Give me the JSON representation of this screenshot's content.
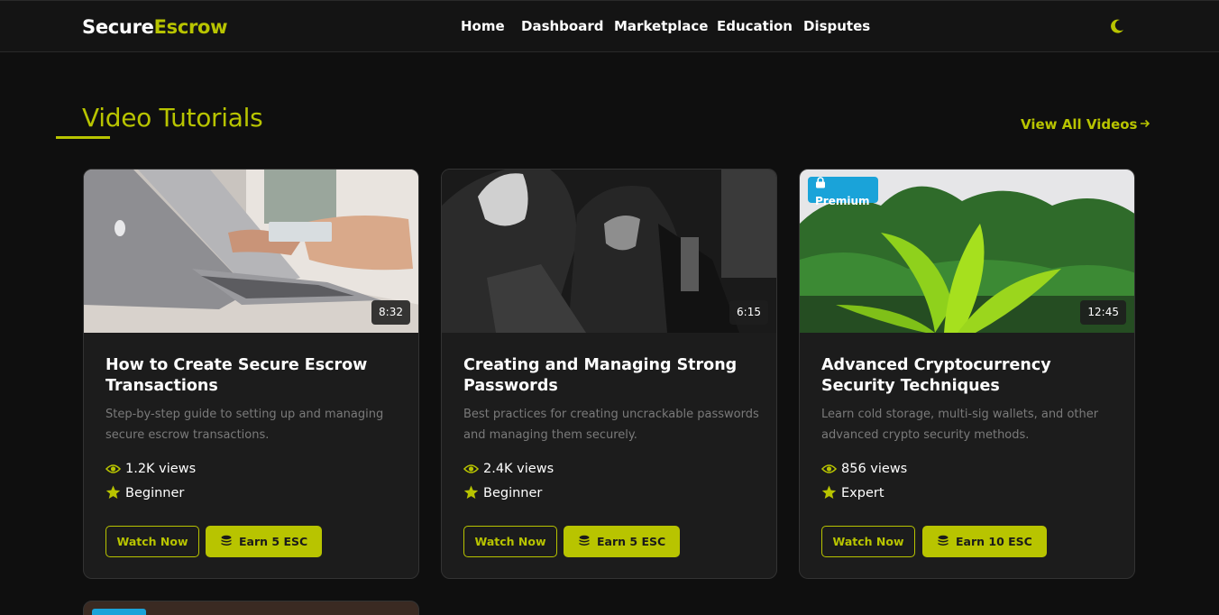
{
  "brand": {
    "part1": "Secure",
    "part2": "Escrow"
  },
  "nav": {
    "links": [
      "Home",
      "Dashboard",
      "Marketplace",
      "Education",
      "Disputes"
    ],
    "theme_icon": "moon-icon"
  },
  "section": {
    "title": "Video Tutorials",
    "view_all": "View All Videos",
    "view_all_icon": "arrow-right-icon"
  },
  "colors": {
    "accent": "#b8c400",
    "premium": "#1aa3d9",
    "background": "#0f0f0f",
    "card": "#1c1c1c"
  },
  "cards": [
    {
      "duration": "8:32",
      "premium": false,
      "title": "How to Create Secure Escrow Transactions",
      "description": "Step-by-step guide to setting up and managing secure escrow transactions.",
      "views": "1.2K views",
      "level": "Beginner",
      "watch_label": "Watch Now",
      "earn_label": "Earn 5 ESC"
    },
    {
      "duration": "6:15",
      "premium": false,
      "title": "Creating and Managing Strong Passwords",
      "description": "Best practices for creating uncrackable passwords and managing them securely.",
      "views": "2.4K views",
      "level": "Beginner",
      "watch_label": "Watch Now",
      "earn_label": "Earn 5 ESC"
    },
    {
      "duration": "12:45",
      "premium": true,
      "premium_label": "Premium",
      "title": "Advanced Cryptocurrency Security Techniques",
      "description": "Learn cold storage, multi-sig wallets, and other advanced crypto security methods.",
      "views": "856 views",
      "level": "Expert",
      "watch_label": "Watch Now",
      "earn_label": "Earn 10 ESC"
    }
  ]
}
